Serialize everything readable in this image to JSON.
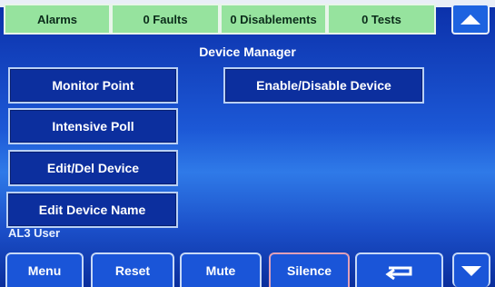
{
  "status_bar": {
    "alarms": "Alarms",
    "faults": "0 Faults",
    "disablements": "0 Disablements",
    "tests": "0 Tests"
  },
  "title": "Device Manager",
  "menu": {
    "monitor_point": "Monitor Point",
    "enable_disable": "Enable/Disable Device",
    "intensive_poll": "Intensive Poll",
    "edit_del": "Edit/Del Device",
    "edit_name": "Edit Device Name"
  },
  "user": "AL3 User",
  "bottom": {
    "menu": "Menu",
    "reset": "Reset",
    "mute": "Mute",
    "silence": "Silence",
    "return_icon": "return-arrow-icon",
    "down_icon": "scroll-down-icon"
  },
  "colors": {
    "status_green": "#96e39e",
    "button_blue": "#0c2f9e",
    "background_blue": "#1c58d6"
  }
}
